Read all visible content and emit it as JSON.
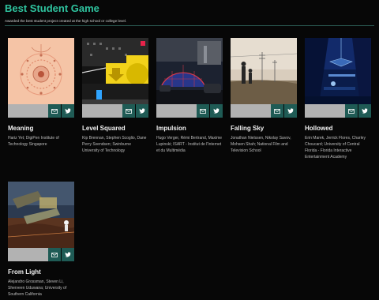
{
  "page": {
    "title": "Best Student Game",
    "subtitle": "Awarded the best student project created at the high school or college level."
  },
  "colors": {
    "accent": "#2fc49f",
    "background": "#070707",
    "share_button": "#1f5b55",
    "share_strip": "#b2b2b2"
  },
  "icons": {
    "share_email": "envelope-icon",
    "share_twitter": "twitter-bird-icon"
  },
  "games": [
    {
      "name": "Meaning",
      "credits": "Hariz Yet; DigiPen Institute of Technology Singapore"
    },
    {
      "name": "Level Squared",
      "credits": "Kip Brennan, Stephen Scoglio, Dane Perry Svendsen; Swinburne University of Technology"
    },
    {
      "name": "Impulsion",
      "credits": "Hugo Verger, Rémi Bertrand, Maxime Lupinski; ISART - Institut de l'Internet et du Multimédia"
    },
    {
      "name": "Falling Sky",
      "credits": "Jonathan Nielssen, Nikolay Savov, Mohsen Shah; National Film and Television School"
    },
    {
      "name": "Hollowed",
      "credits": "Erin Marek, Jerrick Flores, Charley Choucard; University of Central Florida - Florida Interactive Entertainment Academy"
    },
    {
      "name": "From Light",
      "credits": "Alejandro Grossman, Steven Li, Sherveen Uduwana; University of Southern California"
    }
  ]
}
